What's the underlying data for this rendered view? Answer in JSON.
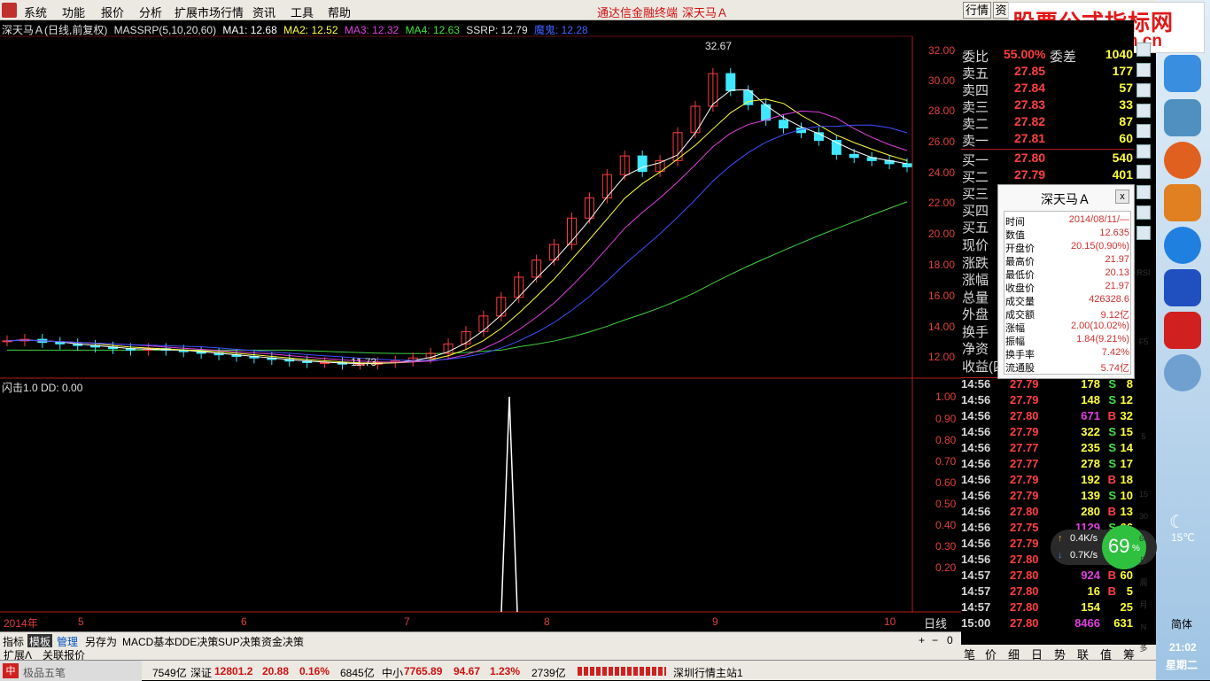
{
  "menu": {
    "items": [
      "系统",
      "功能",
      "报价",
      "分析",
      "扩展市场行情",
      "资讯",
      "工具",
      "帮助"
    ],
    "center_a": "通达信金融终端",
    "center_b": "深天马Ａ",
    "right_a": "行情",
    "right_b": "资"
  },
  "logo": {
    "main": "股票公式指标网",
    "url": "www.gsxz.com.cn"
  },
  "main_header": {
    "stock": "深天马Ａ(日线,前复权)",
    "indicator": "MASSRP(5,10,20,60)",
    "ma1": "MA1: 12.68",
    "ma2": "MA2: 12.52",
    "ma3": "MA3: 12.32",
    "ma4": "MA4: 12.63",
    "ssrp": "SSRP: 12.79",
    "other": "魔鬼: 12.28"
  },
  "price_axis": [
    "32.00",
    "30.00",
    "28.00",
    "26.00",
    "24.00",
    "22.00",
    "20.00",
    "18.00",
    "16.00",
    "14.00",
    "12.00"
  ],
  "annot": {
    "high": "32.67",
    "low": "11.73"
  },
  "sub_header": "闪击1.0  DD: 0.00",
  "sub_axis": [
    "1.00",
    "0.90",
    "0.80",
    "0.70",
    "0.60",
    "0.50",
    "0.40",
    "0.30",
    "0.20"
  ],
  "time_axis": [
    "2014年",
    "5",
    "6",
    "7",
    "8",
    "9",
    "10"
  ],
  "period_label": "日线",
  "zoom": [
    "+",
    "−",
    "0"
  ],
  "chart_data": {
    "type": "line",
    "title": "深天马Ａ(日线,前复权)",
    "ylim": [
      11,
      33
    ],
    "price_close": [
      13.4,
      13.5,
      13.3,
      13.2,
      13.1,
      13.0,
      12.9,
      12.8,
      12.9,
      12.8,
      12.7,
      12.6,
      12.5,
      12.4,
      12.3,
      12.2,
      12.1,
      12.0,
      12.0,
      11.9,
      11.9,
      12.0,
      12.1,
      12.3,
      12.6,
      13.2,
      14.0,
      15.0,
      16.2,
      17.5,
      18.6,
      19.6,
      21.3,
      22.6,
      24.1,
      25.3,
      24.3,
      25.0,
      26.8,
      28.5,
      30.6,
      29.5,
      28.6,
      27.6,
      27.1,
      26.8,
      26.3,
      25.4,
      25.2,
      25.0,
      24.8,
      24.6
    ],
    "sub_values": {
      "peak": 1.0,
      "peak_position": "between 7 and 8"
    }
  },
  "orderbook": {
    "header": {
      "label": "委比",
      "pct": "55.00%",
      "diff": "委差",
      "val": "1040"
    },
    "asks": [
      {
        "label": "卖五",
        "price": "27.85",
        "vol": "177"
      },
      {
        "label": "卖四",
        "price": "27.84",
        "vol": "57"
      },
      {
        "label": "卖三",
        "price": "27.83",
        "vol": "33"
      },
      {
        "label": "卖二",
        "price": "27.82",
        "vol": "87"
      },
      {
        "label": "卖一",
        "price": "27.81",
        "vol": "60"
      }
    ],
    "bids": [
      {
        "label": "买一",
        "price": "27.80",
        "vol": "540"
      },
      {
        "label": "买二",
        "price": "27.79",
        "vol": "401"
      },
      {
        "label": "买三",
        "price": "",
        "vol": ""
      },
      {
        "label": "买四",
        "price": "",
        "vol": ""
      },
      {
        "label": "买五",
        "price": "",
        "vol": ""
      }
    ],
    "stats": [
      "现价",
      "涨跌",
      "涨幅",
      "总量",
      "外盘",
      "换手",
      "净资",
      "收益(四)"
    ]
  },
  "ticks": [
    {
      "t": "14:56",
      "p": "27.79",
      "v": "178",
      "s": "S",
      "r": "8"
    },
    {
      "t": "14:56",
      "p": "27.79",
      "v": "148",
      "s": "S",
      "r": "12"
    },
    {
      "t": "14:56",
      "p": "27.80",
      "v": "671",
      "s": "B",
      "r": "32"
    },
    {
      "t": "14:56",
      "p": "27.79",
      "v": "322",
      "s": "S",
      "r": "15"
    },
    {
      "t": "14:56",
      "p": "27.77",
      "v": "235",
      "s": "S",
      "r": "14"
    },
    {
      "t": "14:56",
      "p": "27.77",
      "v": "278",
      "s": "S",
      "r": "17"
    },
    {
      "t": "14:56",
      "p": "27.79",
      "v": "192",
      "s": "B",
      "r": "18"
    },
    {
      "t": "14:56",
      "p": "27.79",
      "v": "139",
      "s": "S",
      "r": "10"
    },
    {
      "t": "14:56",
      "p": "27.80",
      "v": "280",
      "s": "B",
      "r": "13"
    },
    {
      "t": "14:56",
      "p": "27.75",
      "v": "1129",
      "s": "S",
      "r": "66"
    },
    {
      "t": "14:56",
      "p": "27.79",
      "v": "",
      "s": "",
      "r": ""
    },
    {
      "t": "14:56",
      "p": "27.80",
      "v": "",
      "s": "",
      "r": ""
    },
    {
      "t": "14:57",
      "p": "27.80",
      "v": "924",
      "s": "B",
      "r": "60"
    },
    {
      "t": "14:57",
      "p": "27.80",
      "v": "16",
      "s": "B",
      "r": "5"
    },
    {
      "t": "14:57",
      "p": "27.80",
      "v": "154",
      "s": "",
      "r": "25"
    },
    {
      "t": "15:00",
      "p": "27.80",
      "v": "8466",
      "s": "",
      "r": "631"
    }
  ],
  "popup": {
    "title": "深天马Ａ",
    "close": "x",
    "rows": [
      {
        "k": "时间",
        "v": "2014/08/11/—"
      },
      {
        "k": "数值",
        "v": "12.635"
      },
      {
        "k": "开盘价",
        "v": "20.15(0.90%)"
      },
      {
        "k": "最高价",
        "v": "21.97"
      },
      {
        "k": "最低价",
        "v": "20.13"
      },
      {
        "k": "收盘价",
        "v": "21.97"
      },
      {
        "k": "成交量",
        "v": "426328.6"
      },
      {
        "k": "成交额",
        "v": "9.12亿"
      },
      {
        "k": "涨幅",
        "v": "2.00(10.02%)"
      },
      {
        "k": "振幅",
        "v": "1.84(9.21%)"
      },
      {
        "k": "换手率",
        "v": "7.42%"
      },
      {
        "k": "流通股",
        "v": "5.74亿"
      }
    ]
  },
  "net": {
    "up": "0.4K/s",
    "down": "0.7K/s",
    "pct": "69",
    "pct_sign": "%"
  },
  "bottom_tabs": [
    "指标",
    "模板",
    "管理",
    "另存为",
    "MACD基本",
    "DDE决策",
    "SUP决策",
    "资金决策"
  ],
  "row2": [
    "扩展Λ",
    "关联报价"
  ],
  "quote_tabs": [
    "笔",
    "价",
    "细",
    "日",
    "势",
    "联",
    "值",
    "筹"
  ],
  "status": {
    "input": "极品五笔",
    "sh_amt": "7549亿",
    "sz_label": "深证",
    "sz_val": "12801.2",
    "sz_chg": "20.88",
    "sz_pct": "0.16%",
    "sz_amt": "6845亿",
    "zx_label": "中小",
    "zx_val": "7765.89",
    "zx_chg": "94.67",
    "zx_pct": "1.23%",
    "zx_amt": "2739亿",
    "server": "深圳行情主站1"
  },
  "tray": {
    "temp": "15℃",
    "lang": "简体",
    "time": "21:02",
    "day": "星期二"
  },
  "side_labels": [
    "F10",
    "RSI",
    "F5",
    "5",
    "15",
    "30",
    "60",
    "日",
    "周",
    "月",
    "N",
    "多"
  ]
}
